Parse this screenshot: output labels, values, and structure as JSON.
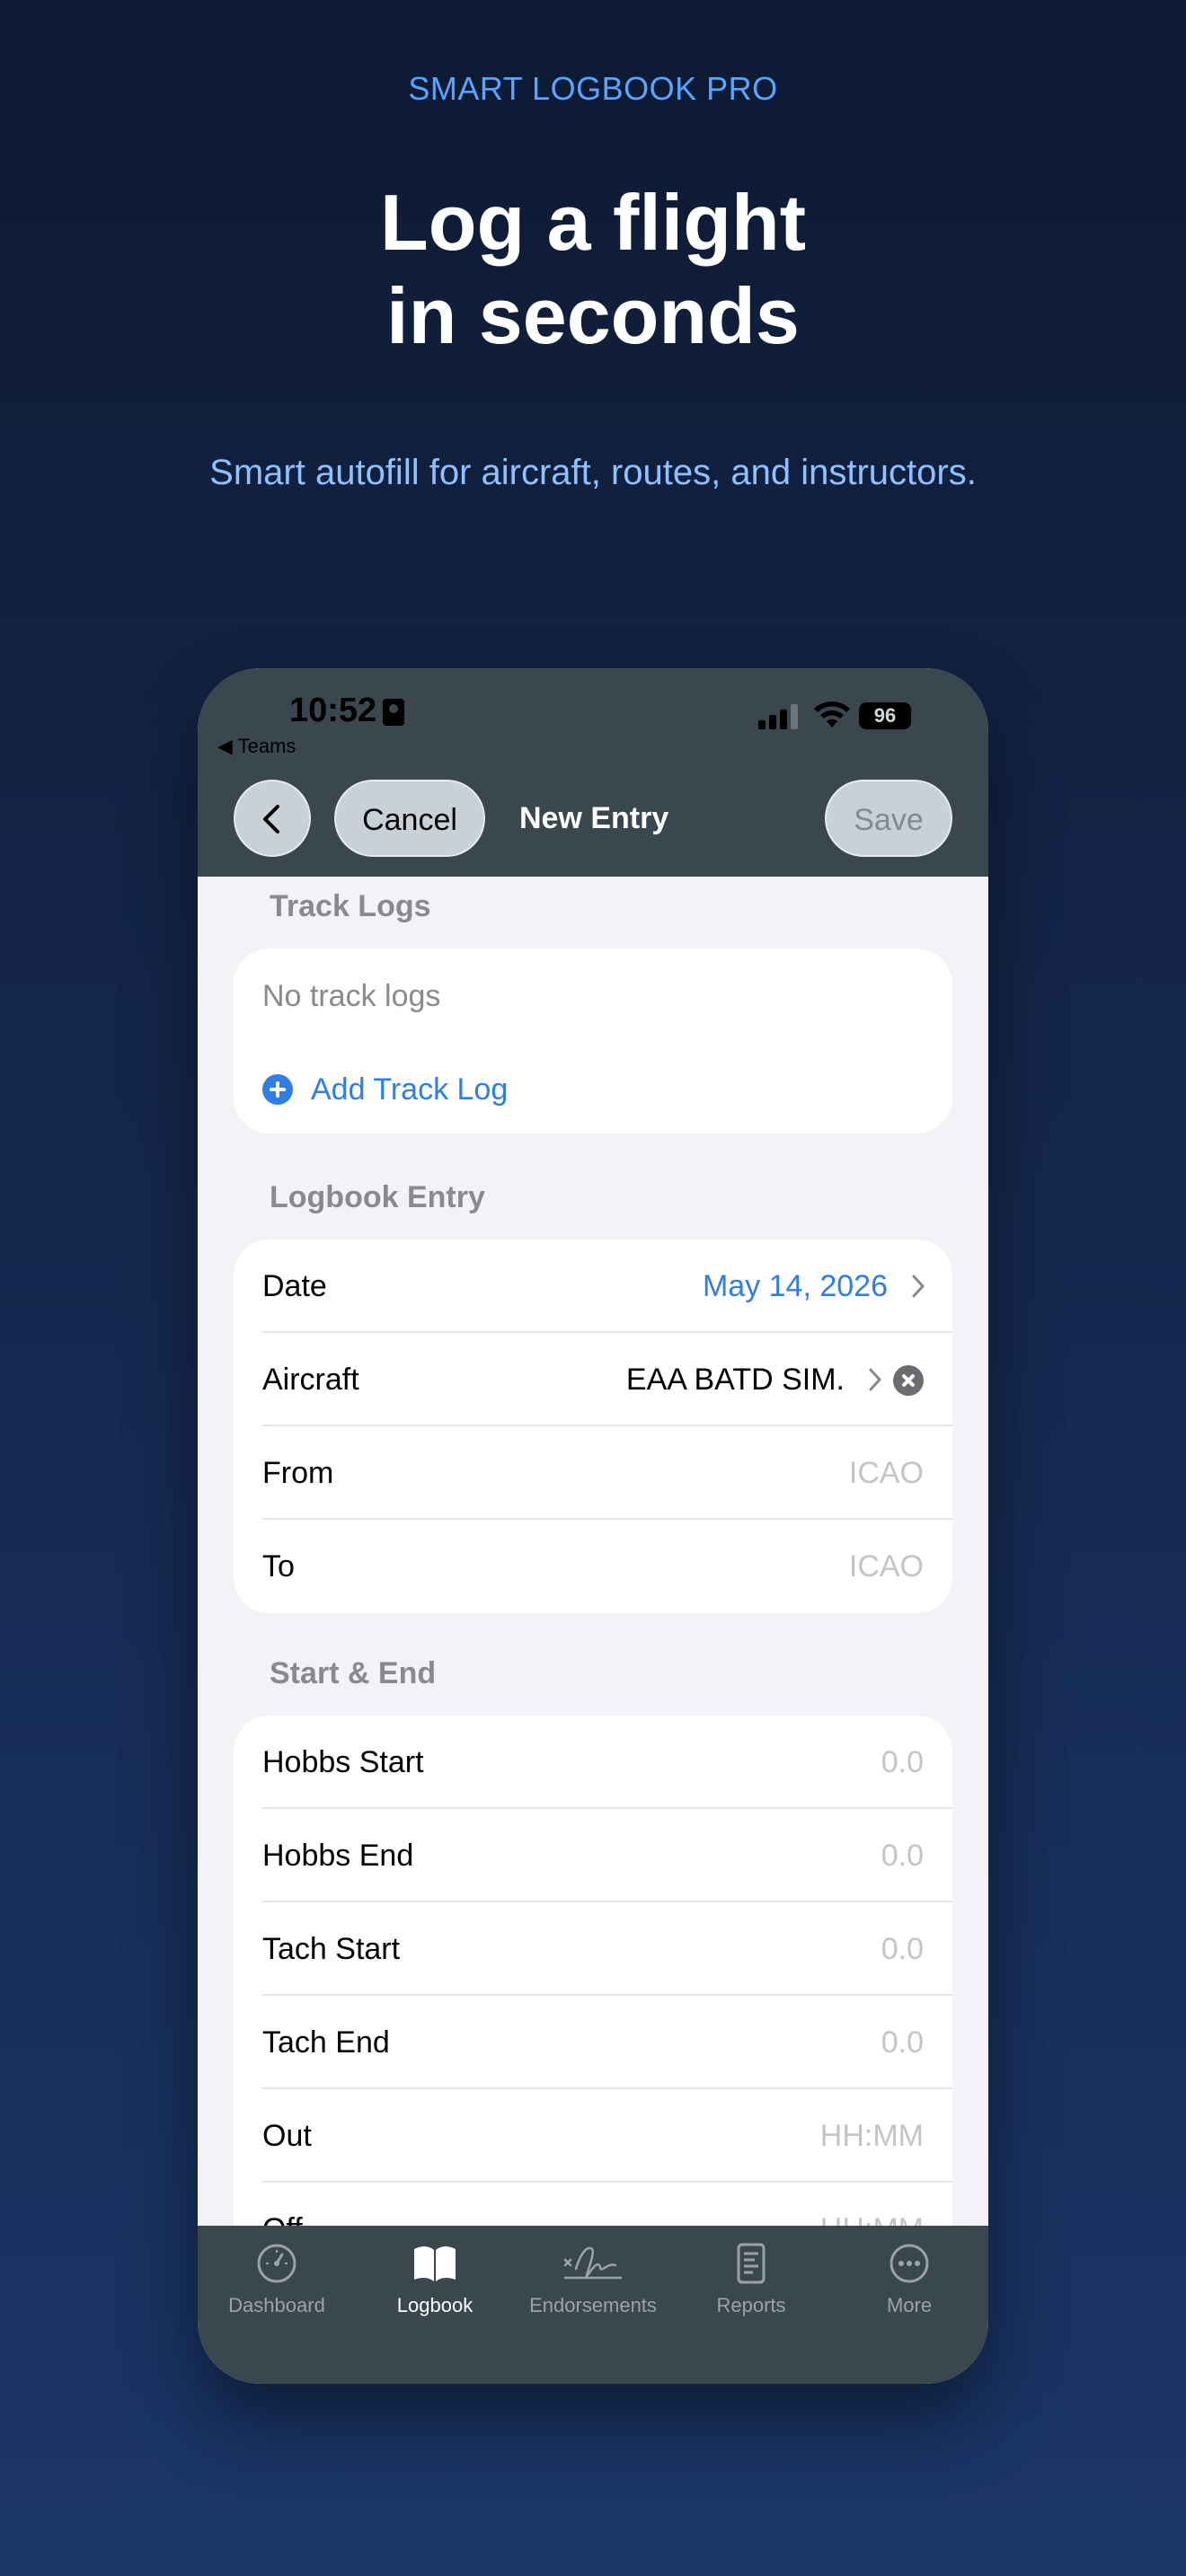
{
  "promo": {
    "eyebrow": "SMART LOGBOOK PRO",
    "headline_line1": "Log a flight",
    "headline_line2": "in seconds",
    "subline": "Smart autofill for aircraft, routes, and instructors."
  },
  "status_bar": {
    "time": "10:52",
    "back_app": "◀ Teams",
    "battery": "96"
  },
  "nav": {
    "cancel_label": "Cancel",
    "title": "New Entry",
    "save_label": "Save"
  },
  "track_logs": {
    "title": "Track Logs",
    "empty_text": "No track logs",
    "add_label": "Add Track Log"
  },
  "logbook_entry": {
    "title": "Logbook Entry",
    "rows": [
      {
        "label": "Date",
        "value": "May 14, 2026"
      },
      {
        "label": "Aircraft",
        "value": "EAA BATD SIM."
      },
      {
        "label": "From",
        "value": "ICAO"
      },
      {
        "label": "To",
        "value": "ICAO"
      }
    ]
  },
  "start_end": {
    "title": "Start & End",
    "rows": [
      {
        "label": "Hobbs Start",
        "value": "0.0"
      },
      {
        "label": "Hobbs End",
        "value": "0.0"
      },
      {
        "label": "Tach Start",
        "value": "0.0"
      },
      {
        "label": "Tach End",
        "value": "0.0"
      },
      {
        "label": "Out",
        "value": "HH:MM"
      },
      {
        "label": "Off",
        "value": "HH:MM"
      }
    ]
  },
  "tabbar": {
    "items": [
      {
        "label": "Dashboard",
        "icon": "gauge-icon"
      },
      {
        "label": "Logbook",
        "icon": "book-icon"
      },
      {
        "label": "Endorsements",
        "icon": "signature-icon"
      },
      {
        "label": "Reports",
        "icon": "document-icon"
      },
      {
        "label": "More",
        "icon": "ellipsis-circle-icon"
      }
    ],
    "active": "Logbook"
  },
  "colors": {
    "accent": "#2f7ee6",
    "bar": "#3b474f",
    "eyebrow": "#5aa3ff",
    "subline": "#8fc1ff"
  }
}
